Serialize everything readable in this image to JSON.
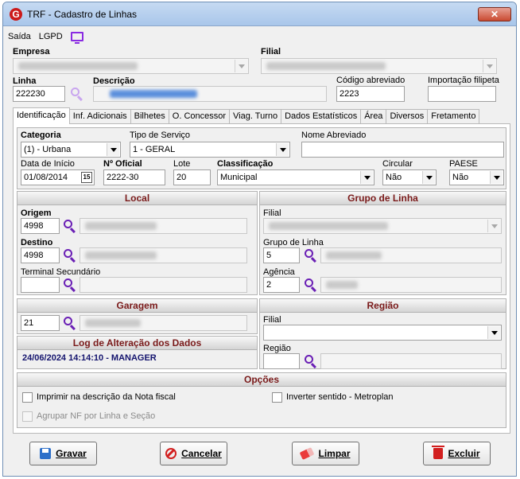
{
  "window": {
    "title": "TRF - Cadastro de Linhas",
    "close_glyph": "✕",
    "app_icon_letter": "G"
  },
  "menu": {
    "items": [
      "Saída",
      "LGPD"
    ],
    "monitor_icon": "monitor-icon"
  },
  "top": {
    "empresa_label": "Empresa",
    "filial_label": "Filial",
    "linha_label": "Linha",
    "linha_value": "222230",
    "descricao_label": "Descrição",
    "codigo_abreviado_label": "Código abreviado",
    "codigo_abreviado_value": "2223",
    "importacao_label": "Importação filipeta",
    "importacao_value": ""
  },
  "tabs": [
    "Identificação",
    "Inf. Adicionais",
    "Bilhetes",
    "O. Concessor",
    "Viag. Turno",
    "Dados Estatísticos",
    "Área",
    "Diversos",
    "Fretamento"
  ],
  "identificacao": {
    "categoria_label": "Categoria",
    "categoria_value": "(1) - Urbana",
    "tipo_servico_label": "Tipo de Serviço",
    "tipo_servico_value": "1 - GERAL",
    "nome_abreviado_label": "Nome Abreviado",
    "nome_abreviado_value": "",
    "data_inicio_label": "Data de Início",
    "data_inicio_value": "01/08/2014",
    "calendar_day": "15",
    "numero_oficial_label": "Nº Oficial",
    "numero_oficial_value": "2222-30",
    "lote_label": "Lote",
    "lote_value": "20",
    "classificacao_label": "Classificação",
    "classificacao_value": "Municipal",
    "circular_label": "Circular",
    "circular_value": "Não",
    "paese_label": "PAESE",
    "paese_value": "Não"
  },
  "local": {
    "title": "Local",
    "origem_label": "Origem",
    "origem_value": "4998",
    "destino_label": "Destino",
    "destino_value": "4998",
    "terminal_label": "Terminal Secundário",
    "terminal_value": ""
  },
  "grupo_linha": {
    "title": "Grupo de Linha",
    "filial_label": "Filial",
    "grupo_label": "Grupo de Linha",
    "grupo_value": "5",
    "agencia_label": "Agência",
    "agencia_value": "2"
  },
  "garagem": {
    "title": "Garagem",
    "value": "21"
  },
  "regiao": {
    "title": "Região",
    "filial_label": "Filial",
    "regiao_label": "Região",
    "regiao_value": ""
  },
  "log": {
    "title": "Log de Alteração dos Dados",
    "text": "24/06/2024 14:14:10 - MANAGER"
  },
  "opcoes": {
    "title": "Opções",
    "imprimir_label": "Imprimir na descrição da Nota fiscal",
    "inverter_label": "Inverter sentido - Metroplan",
    "agrupar_label": "Agrupar NF por Linha e Seção"
  },
  "buttons": {
    "gravar": "Gravar",
    "cancelar": "Cancelar",
    "limpar": "Limpar",
    "excluir": "Excluir"
  }
}
